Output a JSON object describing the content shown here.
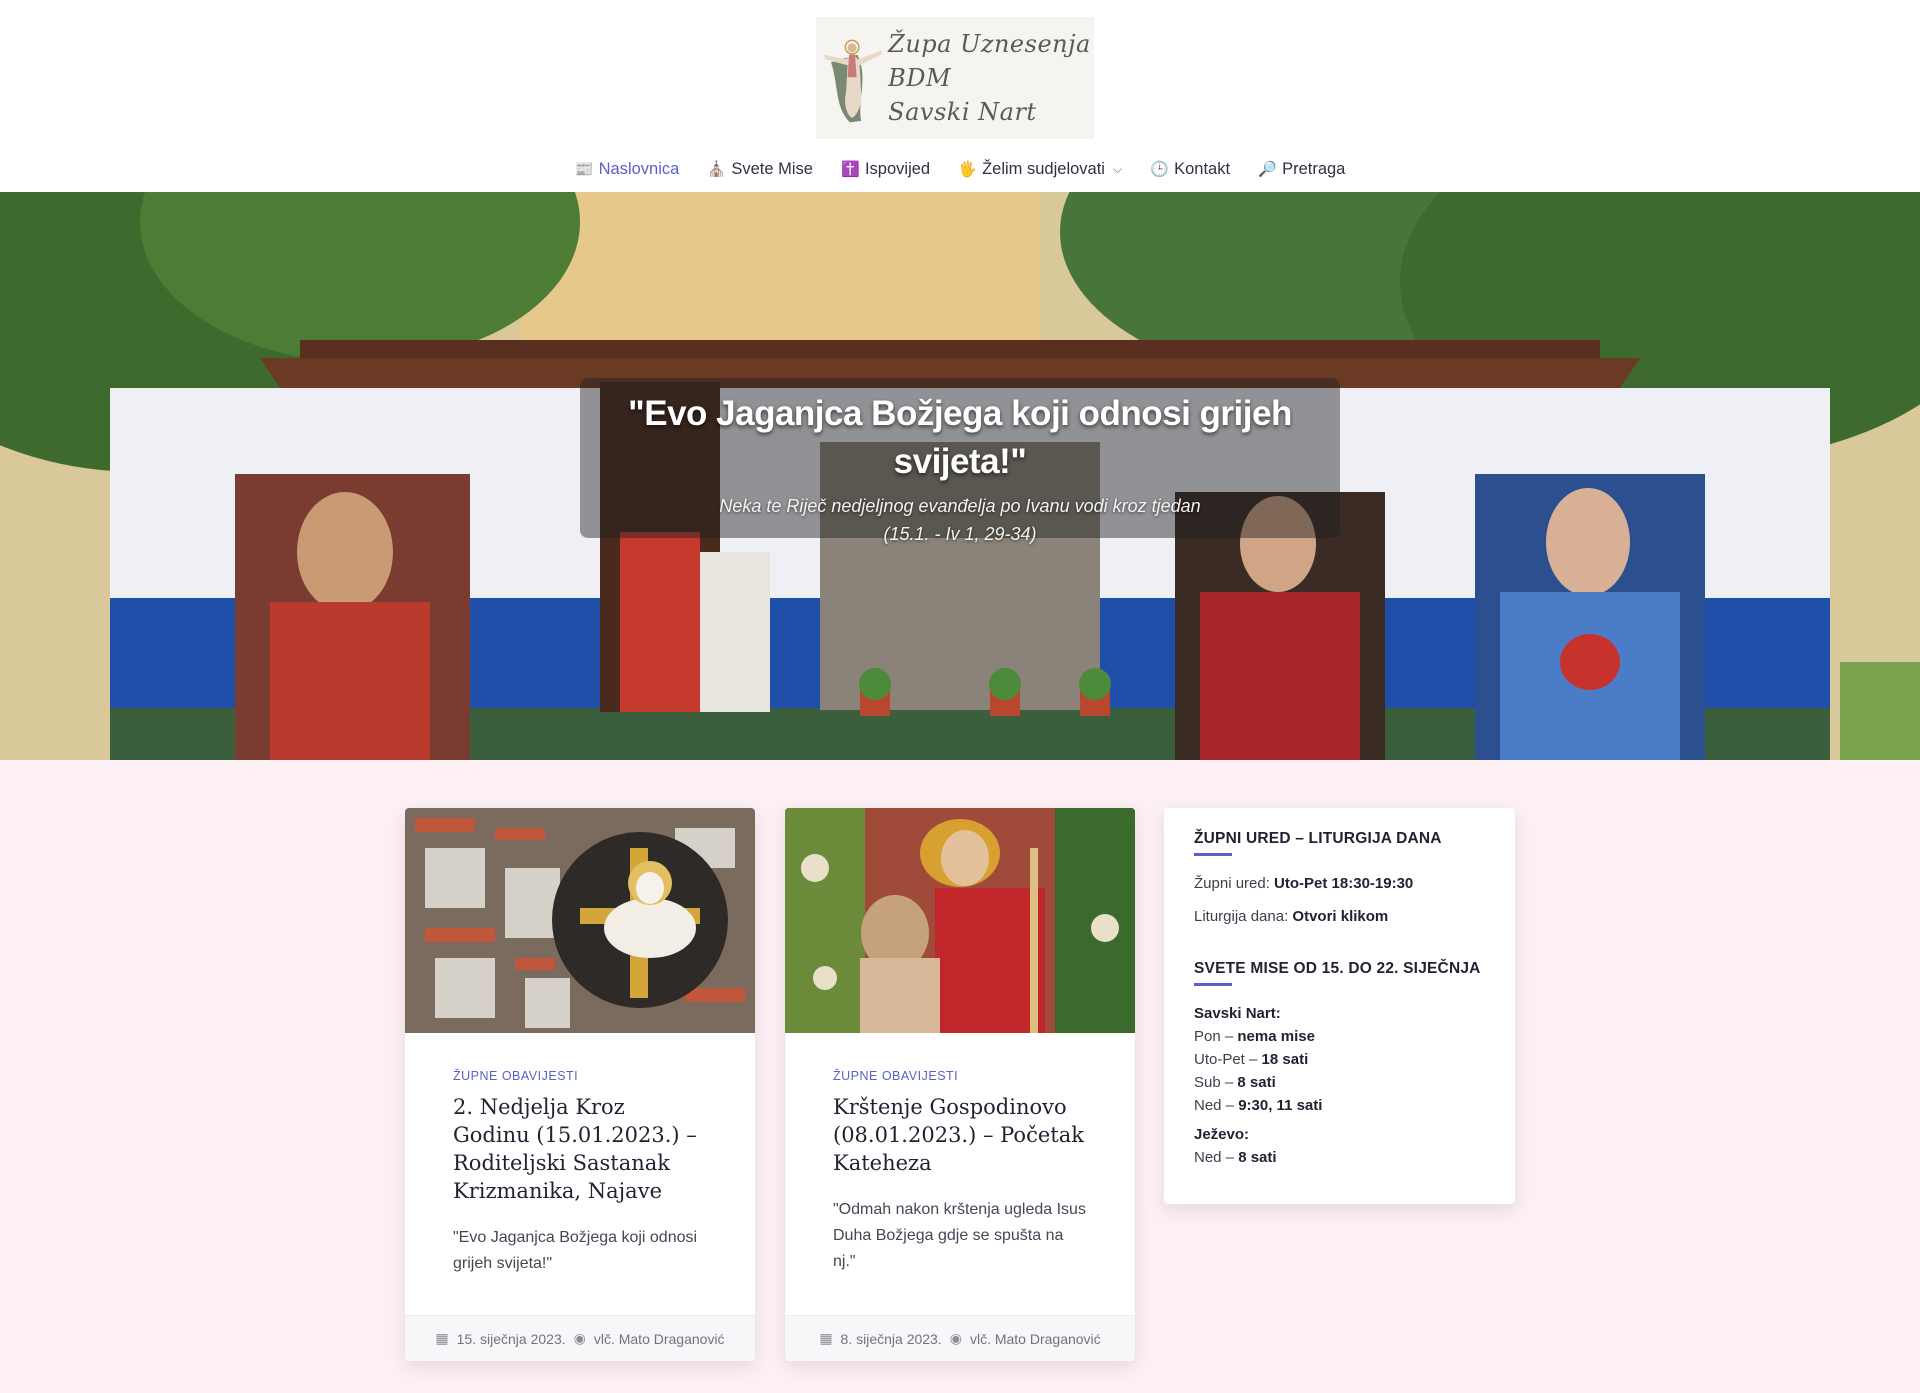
{
  "header": {
    "logo_line1": "Župa Uznesenja BDM",
    "logo_line2": "Savski Nart"
  },
  "nav": [
    {
      "icon": "📰",
      "label": "Naslovnica"
    },
    {
      "icon": "⛪",
      "label": "Svete Mise"
    },
    {
      "icon": "✝️",
      "label": "Ispovijed"
    },
    {
      "icon": "🖐",
      "label": "Želim sudjelovati"
    },
    {
      "icon": "🕒",
      "label": "Kontakt"
    },
    {
      "icon": "🔎",
      "label": "Pretraga"
    }
  ],
  "hero": {
    "title_line1": "\"Evo Jaganjca Božjega koji odnosi grijeh",
    "title_line2": "svijeta!\"",
    "subtitle_line1": "Neka te Riječ nedjeljnog evanđelja po Ivanu vodi kroz tjedan",
    "subtitle_line2": "(15.1. - Iv 1, 29-34)"
  },
  "cards": [
    {
      "category": "ŽUPNE OBAVIJESTI",
      "title": "2. Nedjelja Kroz Godinu (15.01.2023.) – Roditeljski Sastanak Krizmanika, Najave",
      "excerpt": "\"Evo Jaganjca Božjega koji odnosi grijeh svijeta!\"",
      "date": "15. siječnja 2023.",
      "author": "vlč. Mato Draganović"
    },
    {
      "category": "ŽUPNE OBAVIJESTI",
      "title": "Krštenje Gospodinovo (08.01.2023.) – Početak Kateheza",
      "excerpt": "\"Odmah nakon krštenja ugleda Isus Duha Božjega gdje se spušta na nj.\"",
      "date": "8. siječnja 2023.",
      "author": "vlč. Mato Draganović"
    }
  ],
  "sidebar": {
    "heading1": "ŽUPNI URED – LITURGIJA DANA",
    "office_label": "Župni ured: ",
    "office_value": "Uto-Pet 18:30-19:30",
    "liturgy_label": "Liturgija dana: ",
    "liturgy_value": "Otvori klikom",
    "heading2": "SVETE MISE OD 15. DO 22. SIJEČNJA",
    "place1": "Savski Nart:",
    "rows1": [
      {
        "day": "Pon – ",
        "time": "nema mise"
      },
      {
        "day": "Uto-Pet – ",
        "time": "18 sati"
      },
      {
        "day": "Sub – ",
        "time": "8 sati"
      },
      {
        "day": "Ned – ",
        "time": "9:30, 11 sati"
      }
    ],
    "place2": "Ježevo:",
    "rows2": [
      {
        "day": "Ned – ",
        "time": "8 sati"
      }
    ]
  },
  "colors": {
    "accent": "#5b5fc7",
    "page_bg": "#fdf0f4"
  }
}
